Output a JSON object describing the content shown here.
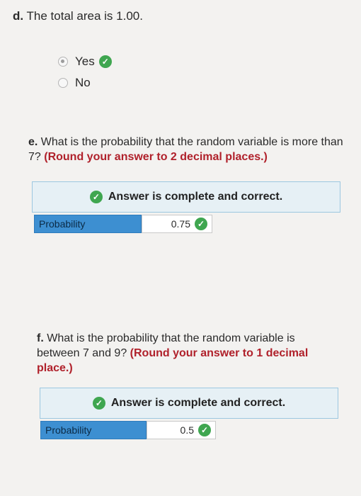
{
  "part_d": {
    "letter": "d.",
    "text": "The total area is 1.00.",
    "options": [
      {
        "label": "Yes",
        "selected": true,
        "correct": true
      },
      {
        "label": "No",
        "selected": false,
        "correct": false
      }
    ]
  },
  "part_e": {
    "letter": "e.",
    "text": "What is the probability that the random variable is more than 7?",
    "instruction": "(Round your answer to 2 decimal places.)",
    "banner": "Answer is complete and correct.",
    "answer_label": "Probability",
    "answer_value": "0.75"
  },
  "part_f": {
    "letter": "f.",
    "text": "What is the probability that the random variable is between 7 and 9?",
    "instruction": "(Round your answer to 1 decimal place.)",
    "banner": "Answer is complete and correct.",
    "answer_label": "Probability",
    "answer_value": "0.5"
  },
  "colors": {
    "correct_green": "#3fa650",
    "instruction_red": "#b0212b",
    "label_blue": "#3d8fd1",
    "banner_bg": "#e6f0f5"
  }
}
